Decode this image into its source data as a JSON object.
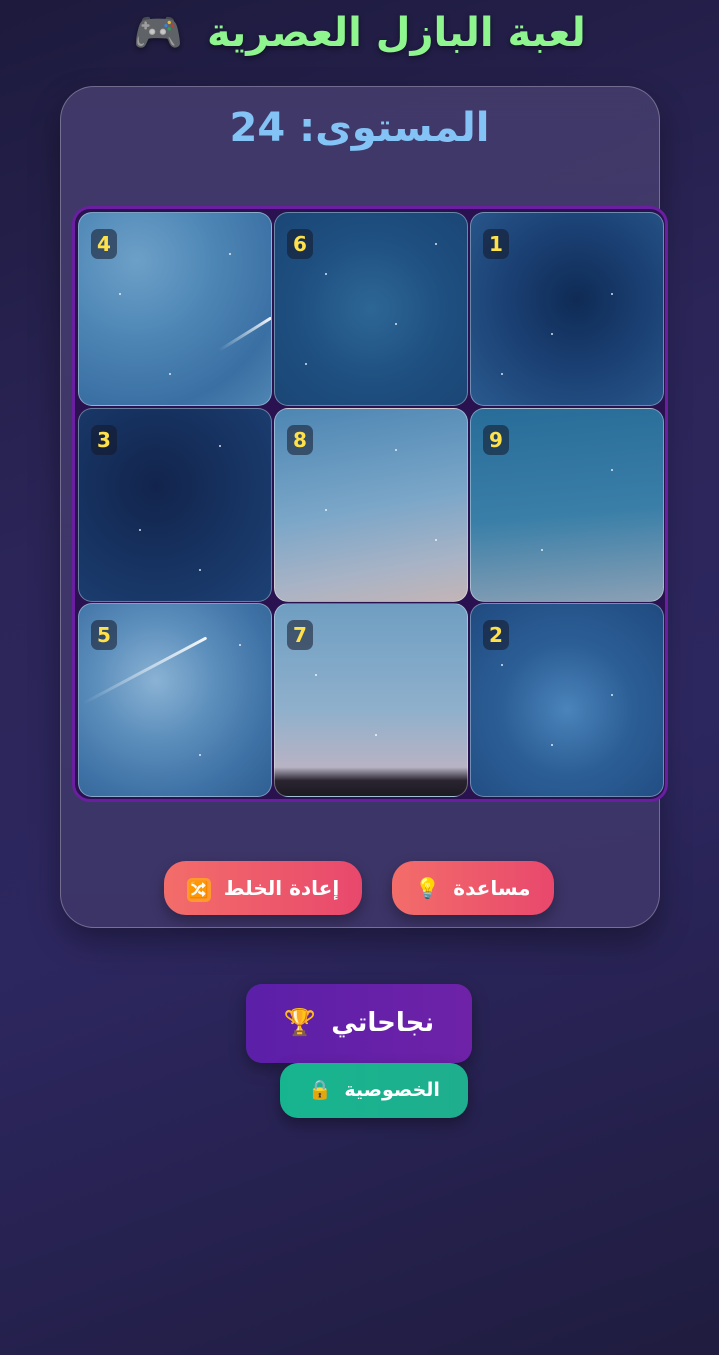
{
  "header": {
    "title": "لعبة البازل العصرية",
    "title_icon": "🎮",
    "title_color": "#8ff58f"
  },
  "level": {
    "label": "المستوى: 24"
  },
  "board": {
    "grid": "3x3",
    "tiles": [
      {
        "number": "4",
        "image": "sky-meteor-upper"
      },
      {
        "number": "6",
        "image": "sky-deep-blue"
      },
      {
        "number": "1",
        "image": "sky-dark-nebula"
      },
      {
        "number": "3",
        "image": "sky-navy"
      },
      {
        "number": "8",
        "image": "sky-milky-horizon"
      },
      {
        "number": "9",
        "image": "sky-teal"
      },
      {
        "number": "5",
        "image": "sky-meteor-milkyway"
      },
      {
        "number": "7",
        "image": "sky-horizon-ground"
      },
      {
        "number": "2",
        "image": "sky-dust-lanes"
      }
    ]
  },
  "controls": {
    "hint_label": "مساعدة",
    "hint_icon": "💡",
    "shuffle_label": "إعادة الخلط",
    "shuffle_icon": "🔀"
  },
  "footer": {
    "achievements_label": "نجاحاتي",
    "achievements_icon": "🏆",
    "privacy_label": "الخصوصية",
    "privacy_icon": "🔒"
  },
  "colors": {
    "number_badge": "#ffe14a",
    "level_text": "#84c3f5",
    "button_gradient_start": "#f36d6a",
    "button_gradient_end": "#e8486c",
    "achievements_bg": "#5b1fa8",
    "privacy_bg": "#17b58f"
  }
}
